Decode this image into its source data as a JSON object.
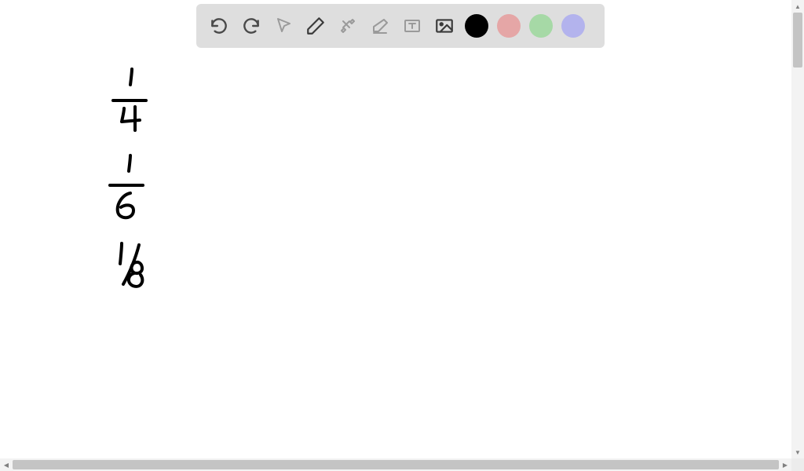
{
  "toolbar": {
    "tools": [
      {
        "name": "undo",
        "enabled": true
      },
      {
        "name": "redo",
        "enabled": true
      },
      {
        "name": "pointer",
        "enabled": false
      },
      {
        "name": "pen",
        "enabled": true
      },
      {
        "name": "tools-crossed",
        "enabled": false
      },
      {
        "name": "eraser",
        "enabled": false
      },
      {
        "name": "text-box",
        "enabled": false
      },
      {
        "name": "image",
        "enabled": true
      }
    ],
    "colors": [
      {
        "name": "black",
        "hex": "#000000",
        "selected": true
      },
      {
        "name": "pink",
        "hex": "#e5a6a6",
        "selected": false
      },
      {
        "name": "green",
        "hex": "#a6d9a6",
        "selected": false
      },
      {
        "name": "purple",
        "hex": "#b3b3ed",
        "selected": false
      }
    ]
  },
  "canvas": {
    "handwritten_content": [
      {
        "type": "fraction",
        "numerator": "1",
        "denominator": "4",
        "display": "1/4"
      },
      {
        "type": "fraction",
        "numerator": "1",
        "denominator": "6",
        "display": "1/6"
      },
      {
        "type": "fraction",
        "numerator": "1",
        "denominator": "8",
        "display": "1/8"
      }
    ]
  }
}
